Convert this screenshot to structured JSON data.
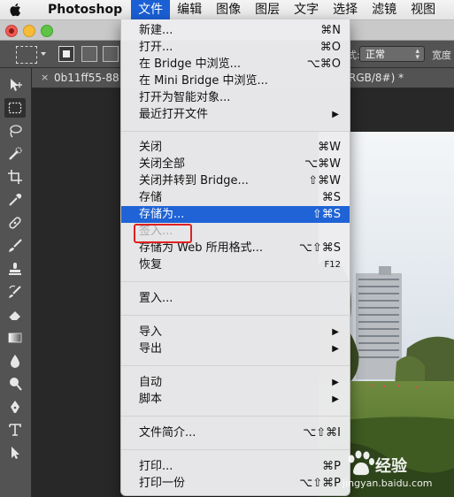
{
  "menubar": {
    "app_name": "Photoshop",
    "items": [
      "文件",
      "编辑",
      "图像",
      "图层",
      "文字",
      "选择",
      "滤镜",
      "视图"
    ],
    "active_index": 0
  },
  "options_bar": {
    "style_label": "式:",
    "style_value": "正常",
    "width_label": "宽度"
  },
  "document_tab": {
    "close_glyph": "×",
    "title": "0b11ff55-88",
    "suffix": "RGB/8#) *"
  },
  "file_menu": {
    "items": [
      {
        "label": "新建...",
        "shortcut": "⌘N"
      },
      {
        "label": "打开...",
        "shortcut": "⌘O"
      },
      {
        "label": "在 Bridge 中浏览...",
        "shortcut": "⌥⌘O"
      },
      {
        "label": "在 Mini Bridge 中浏览...",
        "shortcut": ""
      },
      {
        "label": "打开为智能对象...",
        "shortcut": ""
      },
      {
        "label": "最近打开文件",
        "shortcut": "",
        "submenu": "▶"
      },
      {
        "label": "关闭",
        "shortcut": "⌘W"
      },
      {
        "label": "关闭全部",
        "shortcut": "⌥⌘W"
      },
      {
        "label": "关闭并转到 Bridge...",
        "shortcut": "⇧⌘W"
      },
      {
        "label": "存储",
        "shortcut": "⌘S"
      },
      {
        "label": "存储为...",
        "shortcut": "⇧⌘S",
        "highlighted": true
      },
      {
        "label": "签入...",
        "shortcut": "",
        "disabled": true
      },
      {
        "label": "存储为 Web 所用格式...",
        "shortcut": "⌥⇧⌘S"
      },
      {
        "label": "恢复",
        "shortcut": "F12"
      },
      {
        "label": "置入...",
        "shortcut": ""
      },
      {
        "label": "导入",
        "shortcut": "",
        "submenu": "▶"
      },
      {
        "label": "导出",
        "shortcut": "",
        "submenu": "▶"
      },
      {
        "label": "自动",
        "shortcut": "",
        "submenu": "▶"
      },
      {
        "label": "脚本",
        "shortcut": "",
        "submenu": "▶"
      },
      {
        "label": "文件简介...",
        "shortcut": "⌥⇧⌘I"
      },
      {
        "label": "打印...",
        "shortcut": "⌘P"
      },
      {
        "label": "打印一份",
        "shortcut": "⌥⇧⌘P"
      }
    ]
  },
  "watermark": {
    "brand": "经验",
    "url": "jingyan.baidu.com"
  },
  "colors": {
    "menu_highlight": "#1f63d6",
    "annotation_box": "#e02020",
    "panel_gray": "#535353"
  }
}
